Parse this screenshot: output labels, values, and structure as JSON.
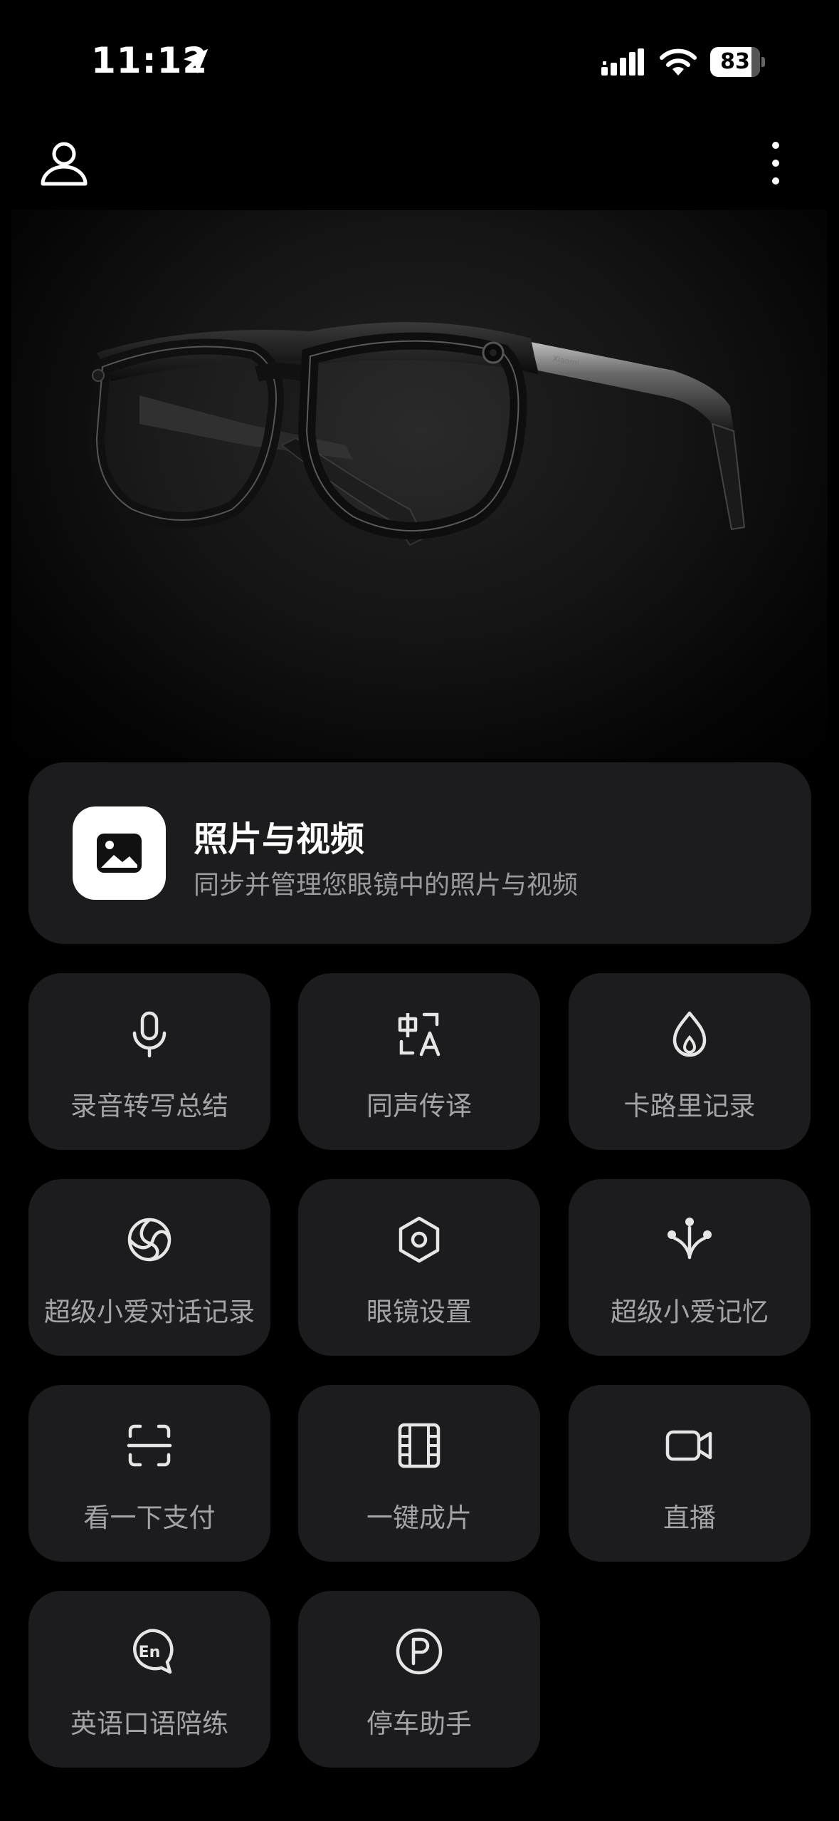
{
  "status": {
    "time": "11:12",
    "battery": "83",
    "battery_level": 0.83
  },
  "header": {
    "profile_icon": "person-icon",
    "more_icon": "vertical-ellipsis-icon"
  },
  "hero": {
    "brand_text": "Xiaomi"
  },
  "photos_card": {
    "title": "照片与视频",
    "subtitle": "同步并管理您眼镜中的照片与视频",
    "icon": "image-icon"
  },
  "features": [
    {
      "label": "录音转写总结",
      "icon": "microphone-icon"
    },
    {
      "label": "同声传译",
      "icon": "translate-icon"
    },
    {
      "label": "卡路里记录",
      "icon": "flame-icon"
    },
    {
      "label": "超级小爱对话记录",
      "icon": "ai-swirl-icon"
    },
    {
      "label": "眼镜设置",
      "icon": "hexagon-settings-icon"
    },
    {
      "label": "超级小爱记忆",
      "icon": "memory-nodes-icon"
    },
    {
      "label": "看一下支付",
      "icon": "scan-pay-icon"
    },
    {
      "label": "一键成片",
      "icon": "film-icon"
    },
    {
      "label": "直播",
      "icon": "video-camera-icon"
    },
    {
      "label": "英语口语陪练",
      "icon": "english-chat-icon"
    },
    {
      "label": "停车助手",
      "icon": "parking-icon"
    }
  ],
  "colors": {
    "background": "#000000",
    "card": "#1c1c1e",
    "label": "#a3a3a8",
    "subtitle": "#9a9a9f"
  }
}
